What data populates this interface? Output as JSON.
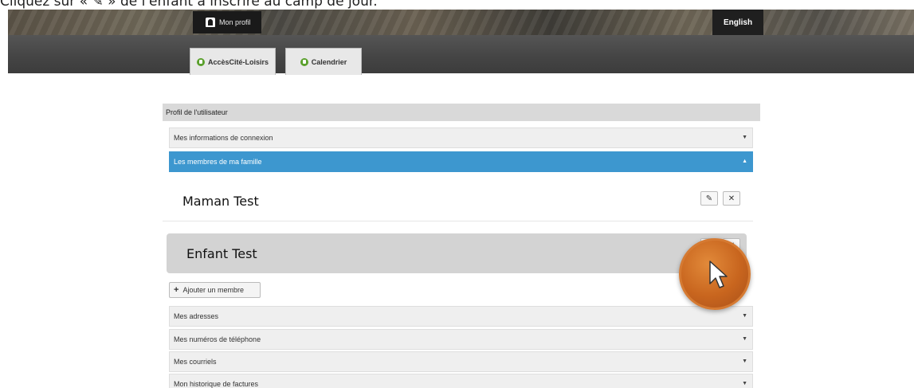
{
  "caption": "Cliquez sur « ✎ » de l'enfant à inscrire au camp de jour.",
  "header": {
    "profile_label": "Mon profil",
    "language_label": "English"
  },
  "nav": {
    "tabs": [
      {
        "label": "AccèsCité-Loisirs",
        "icon": "leisure-icon"
      },
      {
        "label": "Calendrier",
        "icon": "calendar-icon"
      }
    ]
  },
  "panel": {
    "title": "Profil de l'utilisateur",
    "sections": [
      {
        "label": "Mes informations de connexion",
        "state": "collapsed"
      },
      {
        "label": "Les membres de ma famille",
        "state": "expanded"
      },
      {
        "label": "Mes adresses",
        "state": "collapsed"
      },
      {
        "label": "Mes numéros de téléphone",
        "state": "collapsed"
      },
      {
        "label": "Mes courriels",
        "state": "collapsed"
      },
      {
        "label": "Mon historique de factures",
        "state": "collapsed"
      }
    ],
    "members": [
      {
        "name": "Maman Test"
      },
      {
        "name": "Enfant Test"
      }
    ],
    "add_member_label": "Ajouter un membre"
  },
  "colors": {
    "accent": "#3d97cf",
    "cursor_badge": "#c8651e",
    "nav_bg": "#444444"
  }
}
